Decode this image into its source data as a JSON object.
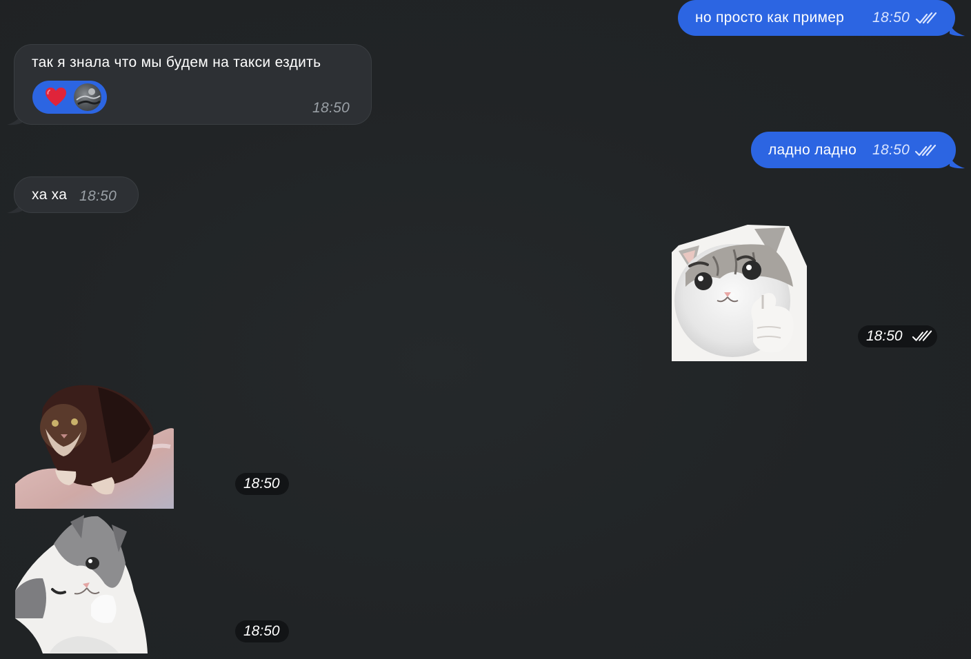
{
  "messages": [
    {
      "direction": "out",
      "text": "но просто как пример",
      "time": "18:50",
      "status": "read-double-check"
    },
    {
      "direction": "in",
      "text": "так я знала что мы будем на такси ездить",
      "time": "18:50",
      "reactions": [
        {
          "icon": "heart-icon"
        },
        {
          "icon": "user-avatar"
        }
      ]
    },
    {
      "direction": "out",
      "text": "ладно ладно",
      "time": "18:50",
      "status": "read-double-check"
    },
    {
      "direction": "in",
      "text": "ха ха",
      "time": "18:50"
    },
    {
      "direction": "out",
      "type": "sticker",
      "sticker": "grey-white-cat-thumbs-up",
      "time": "18:50",
      "status": "read-double-check"
    },
    {
      "direction": "in",
      "type": "sticker",
      "sticker": "dark-cat-on-pillow",
      "time": "18:50"
    },
    {
      "direction": "in",
      "type": "sticker",
      "sticker": "winking-grey-white-cat",
      "time": "18:50"
    }
  ],
  "colors": {
    "background": "#212426",
    "outgoing_bubble": "#2c65e2",
    "incoming_bubble": "#2d3034",
    "time_pill": "#121416",
    "heart": "#e0243a"
  }
}
